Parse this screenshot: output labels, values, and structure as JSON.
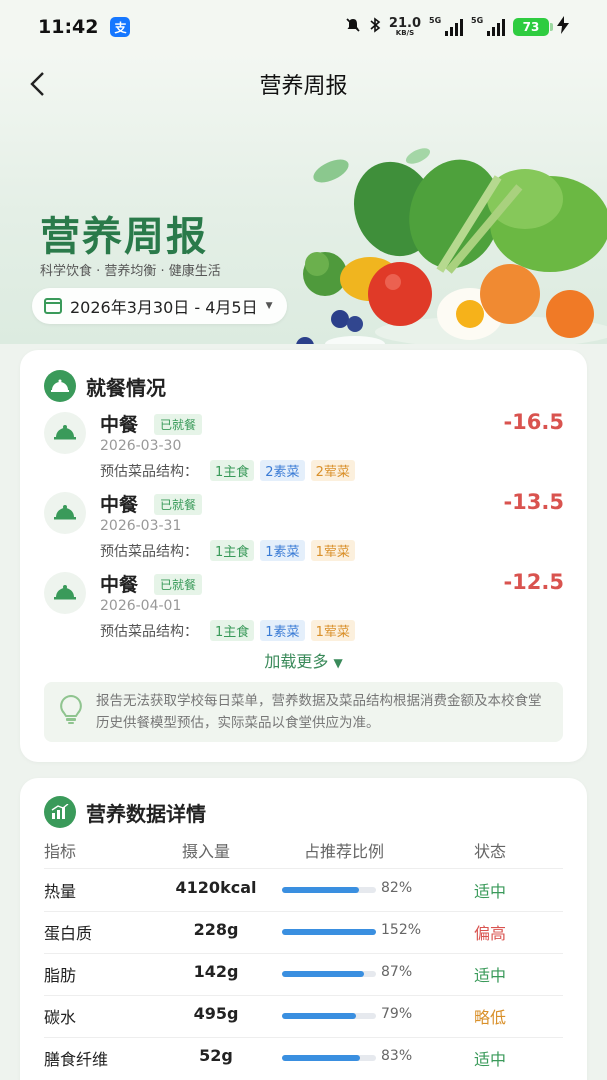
{
  "status_bar": {
    "time": "11:42",
    "app_badge": "支",
    "net_speed_value": "21.0",
    "net_speed_unit": "KB/S",
    "signal_1": "5G",
    "signal_2": "5G",
    "battery": "73"
  },
  "nav": {
    "title": "营养周报"
  },
  "hero": {
    "title": "营养周报",
    "subtitle": "科学饮食 · 营养均衡 · 健康生活",
    "date_range": "2026年3月30日 - 4月5日"
  },
  "meals_section": {
    "title": "就餐情况",
    "struct_label": "预估菜品结构：",
    "meals": [
      {
        "name": "中餐",
        "status": "已就餐",
        "date": "2026-03-30",
        "amount": "-16.5",
        "tags": [
          "1主食",
          "2素菜",
          "2荤菜"
        ]
      },
      {
        "name": "中餐",
        "status": "已就餐",
        "date": "2026-03-31",
        "amount": "-13.5",
        "tags": [
          "1主食",
          "1素菜",
          "1荤菜"
        ]
      },
      {
        "name": "中餐",
        "status": "已就餐",
        "date": "2026-04-01",
        "amount": "-12.5",
        "tags": [
          "1主食",
          "1素菜",
          "1荤菜"
        ]
      }
    ],
    "load_more": "加载更多",
    "notice": "报告无法获取学校每日菜单，营养数据及菜品结构根据消费金额及本校食堂历史供餐模型预估，实际菜品以食堂供应为准。"
  },
  "nutrition_section": {
    "title": "营养数据详情",
    "headers": {
      "indicator": "指标",
      "intake": "摄入量",
      "ratio": "占推荐比例",
      "status": "状态"
    },
    "rows": [
      {
        "name": "热量",
        "intake": "4120kcal",
        "percent": 82,
        "percent_label": "82%",
        "status": "适中",
        "status_color": "#3a9a5a"
      },
      {
        "name": "蛋白质",
        "intake": "228g",
        "percent": 152,
        "percent_label": "152%",
        "status": "偏高",
        "status_color": "#d9534f"
      },
      {
        "name": "脂肪",
        "intake": "142g",
        "percent": 87,
        "percent_label": "87%",
        "status": "适中",
        "status_color": "#3a9a5a"
      },
      {
        "name": "碳水",
        "intake": "495g",
        "percent": 79,
        "percent_label": "79%",
        "status": "略低",
        "status_color": "#d9902a"
      },
      {
        "name": "膳食纤维",
        "intake": "52g",
        "percent": 83,
        "percent_label": "83%",
        "status": "适中",
        "status_color": "#3a9a5a"
      }
    ]
  },
  "colors": {
    "brand_green": "#3a9a5a",
    "amount_red": "#d9534f",
    "bar_blue": "#3a8fe0"
  }
}
